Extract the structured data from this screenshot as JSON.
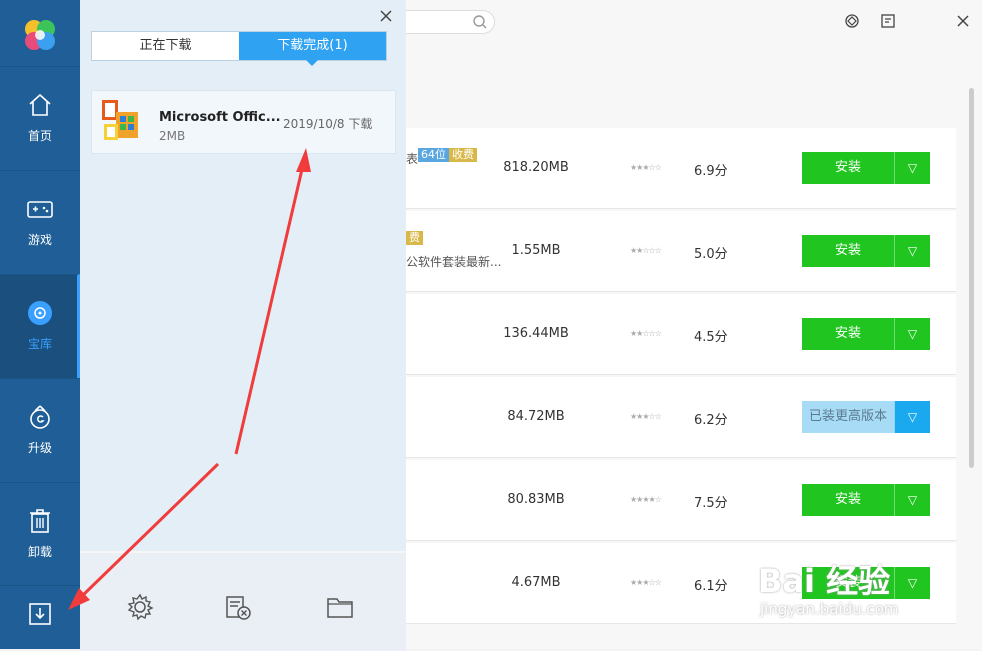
{
  "sidebar": {
    "items": [
      {
        "label": "首页",
        "icon": "home-icon"
      },
      {
        "label": "游戏",
        "icon": "gamepad-icon"
      },
      {
        "label": "宝库",
        "icon": "disc-icon"
      },
      {
        "label": "升级",
        "icon": "upgrade-icon"
      },
      {
        "label": "卸载",
        "icon": "trash-icon"
      }
    ],
    "active": "宝库",
    "download_icon": "download-icon"
  },
  "panel": {
    "tabs": [
      "正在下载",
      "下载完成(1)"
    ],
    "active_tab": "下载完成(1)",
    "item": {
      "name": "Microsoft Offic...",
      "size": "2MB",
      "date": "2019/10/8 下载"
    },
    "footer_icons": [
      "settings-icon",
      "clear-list-icon",
      "folder-icon"
    ]
  },
  "main": {
    "rows": [
      {
        "desc": "表",
        "tags": [
          "64位",
          "收费"
        ],
        "size": "818.20MB",
        "score": "6.9分",
        "button": "安装"
      },
      {
        "desc": "公软件套装最新...",
        "tags": [
          "费"
        ],
        "size": "1.55MB",
        "score": "5.0分",
        "button": "安装"
      },
      {
        "desc": "",
        "tags": [],
        "size": "136.44MB",
        "score": "4.5分",
        "button": "安装"
      },
      {
        "desc": "",
        "tags": [],
        "size": "84.72MB",
        "score": "6.2分",
        "button": "已装更高版本"
      },
      {
        "desc": "",
        "tags": [],
        "size": "80.83MB",
        "score": "7.5分",
        "button": "安装"
      },
      {
        "desc": "",
        "tags": [],
        "size": "4.67MB",
        "score": "6.1分",
        "button": "安装"
      }
    ]
  },
  "watermark": {
    "brand": "Bai 经验",
    "url": "jingyan.baidu.com"
  },
  "colors": {
    "sidebar": "#1f5e96",
    "accent": "#2fa2f1",
    "install": "#20c61f",
    "arrow": "#f03c3c"
  }
}
